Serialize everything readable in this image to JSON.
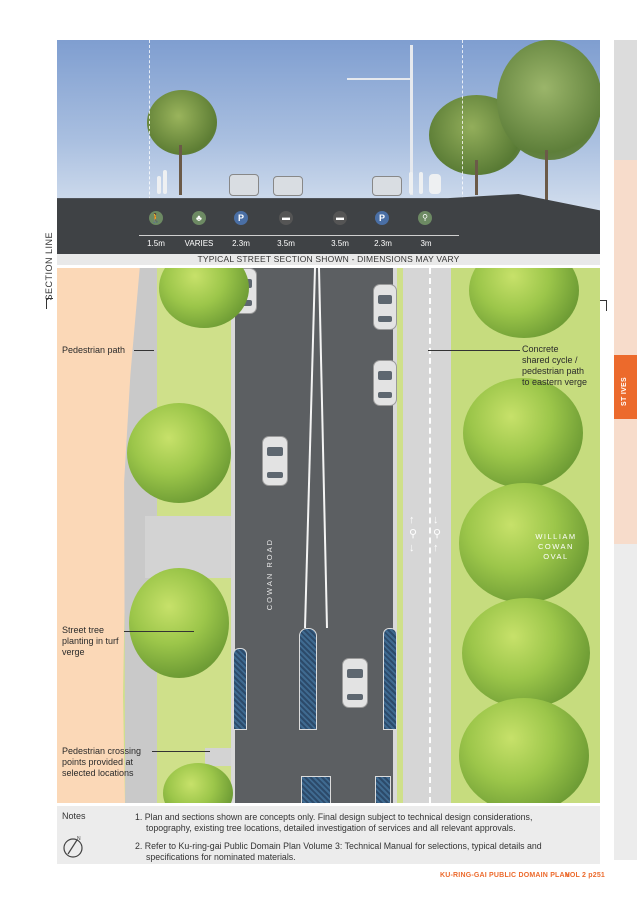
{
  "section": {
    "caption": "TYPICAL STREET SECTION SHOWN - DIMENSIONS MAY VARY",
    "section_line_label": "SECTION LINE",
    "dimensions": [
      {
        "icon": "pedestrian-icon",
        "value": "1.5m"
      },
      {
        "icon": "tree-icon",
        "value": "VARIES"
      },
      {
        "icon": "parking-icon",
        "value": "2.3m"
      },
      {
        "icon": "car-icon",
        "value": "3.5m"
      },
      {
        "icon": "car-icon",
        "value": "3.5m"
      },
      {
        "icon": "parking-icon",
        "value": "2.3m"
      },
      {
        "icon": "cycle-pedestrian-icon",
        "value": "3m"
      }
    ]
  },
  "plan": {
    "labels": {
      "pedestrian_path": "Pedestrian path",
      "shared_path": [
        "Concrete",
        "shared cycle /",
        "pedestrian path",
        "to eastern verge"
      ],
      "street_tree": [
        "Street tree",
        "planting in turf",
        "verge"
      ],
      "crossing": [
        "Pedestrian crossing",
        "points provided at",
        "selected locations"
      ],
      "road_name": "COWAN ROAD",
      "oval_name": [
        "WILLIAM",
        "COWAN",
        "OVAL"
      ]
    }
  },
  "side_tab": {
    "label": "ST IVES",
    "accent": "#ec6a2c"
  },
  "notes": {
    "heading": "Notes",
    "items": [
      [
        "1. Plan and sections shown are concepts only. Final design subject to technical design considerations,",
        "topography, existing tree locations, detailed investigation of services and all relevant approvals."
      ],
      [
        "2. Refer to Ku-ring-gai Public Domain Plan Volume 3: Technical Manual for selections, typical details and",
        "specifications for nominated materials."
      ]
    ]
  },
  "footer": {
    "title": "KU-RING-GAI PUBLIC DOMAIN PLAN",
    "page": "VOL 2 p251"
  }
}
